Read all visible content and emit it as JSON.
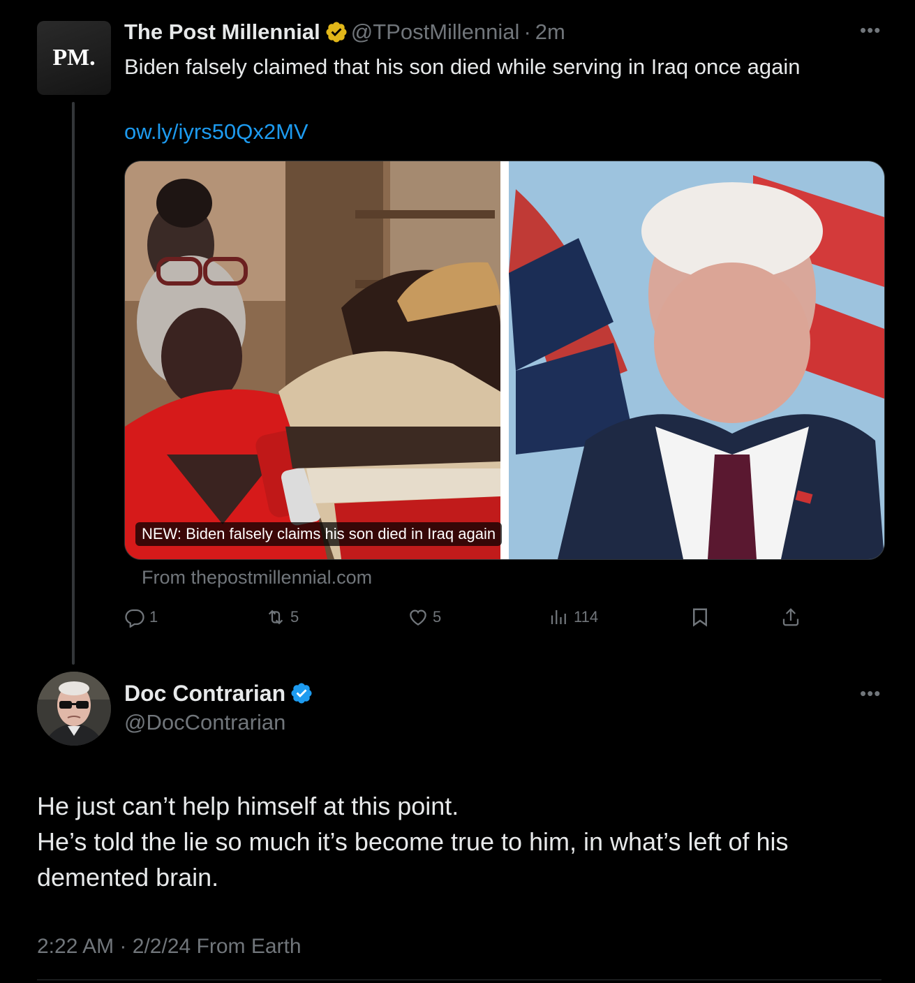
{
  "quoted_tweet": {
    "avatar_text": "PM.",
    "name": "The Post Millennial",
    "handle": "@TPostMillennial",
    "separator": "·",
    "time": "2m",
    "text": "Biden falsely claimed that his son died while serving in Iraq once again",
    "link": "ow.ly/iyrs50Qx2MV",
    "media_caption": "NEW: Biden falsely claims his son died in Iraq again",
    "source": "From thepostmillennial.com",
    "verified_color": "#e2b719",
    "actions": {
      "replies": "1",
      "reposts": "5",
      "likes": "5",
      "views": "114"
    },
    "more_icon": "ellipsis-icon"
  },
  "main_tweet": {
    "name": "Doc Contrarian",
    "handle": "@DocContrarian",
    "verified_color": "#1d9bf0",
    "text_lines": [
      "He just can’t help himself at this point.",
      "He’s told the lie so much it’s become true to him, in what’s left of his demented brain."
    ],
    "time": "2:22 AM",
    "separator": "·",
    "date": "2/2/24",
    "location": "From Earth",
    "more_icon": "ellipsis-icon"
  },
  "colors": {
    "background": "#000000",
    "text_primary": "#e7e9ea",
    "text_secondary": "#71767b",
    "link": "#1d9bf0"
  }
}
